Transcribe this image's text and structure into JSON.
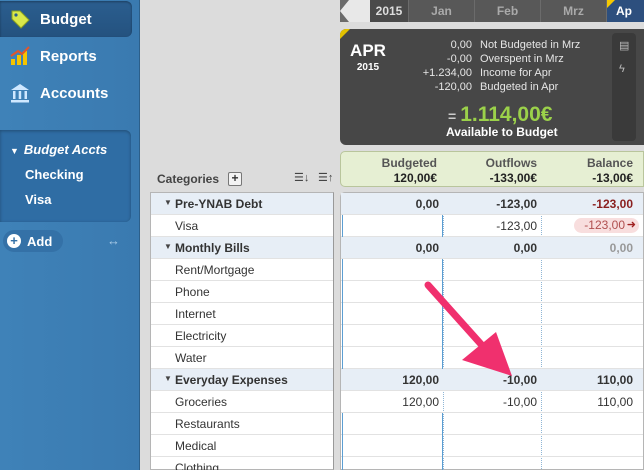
{
  "sidebar": {
    "nav": [
      {
        "label": "Budget",
        "icon": "tag-icon"
      },
      {
        "label": "Reports",
        "icon": "chart-icon"
      },
      {
        "label": "Accounts",
        "icon": "bank-icon"
      }
    ],
    "accounts_header": "Budget Accts",
    "accounts": [
      "Checking",
      "Visa"
    ],
    "add_label": "Add"
  },
  "months": {
    "year": "2015",
    "items": [
      "Jan",
      "Feb",
      "Mrz",
      "Ap"
    ]
  },
  "summary": {
    "month": "APR",
    "year": "2015",
    "rows": [
      {
        "value": "0,00",
        "label": "Not Budgeted in Mrz"
      },
      {
        "value": "-0,00",
        "label": "Overspent in Mrz"
      },
      {
        "value": "+1.234,00",
        "label": "Income for Apr"
      },
      {
        "value": "-120,00",
        "label": "Budgeted in Apr"
      }
    ],
    "equals": "=",
    "available_amount": "1.114,00€",
    "available_label": "Available to Budget"
  },
  "categories_header": {
    "title": "Categories",
    "add": "+"
  },
  "columns": {
    "budgeted": {
      "title": "Budgeted",
      "total": "120,00€"
    },
    "outflows": {
      "title": "Outflows",
      "total": "-133,00€"
    },
    "balance": {
      "title": "Balance",
      "total": "-13,00€"
    }
  },
  "rows": [
    {
      "type": "group",
      "name": "Pre-YNAB Debt",
      "budgeted": "0,00",
      "outflows": "-123,00",
      "balance": "-123,00"
    },
    {
      "type": "item",
      "name": "Visa",
      "budgeted": "",
      "outflows": "-123,00",
      "balance": "-123,00"
    },
    {
      "type": "group",
      "name": "Monthly Bills",
      "budgeted": "0,00",
      "outflows": "0,00",
      "balance": "0,00"
    },
    {
      "type": "item",
      "name": "Rent/Mortgage",
      "budgeted": "",
      "outflows": "",
      "balance": ""
    },
    {
      "type": "item",
      "name": "Phone",
      "budgeted": "",
      "outflows": "",
      "balance": ""
    },
    {
      "type": "item",
      "name": "Internet",
      "budgeted": "",
      "outflows": "",
      "balance": ""
    },
    {
      "type": "item",
      "name": "Electricity",
      "budgeted": "",
      "outflows": "",
      "balance": ""
    },
    {
      "type": "item",
      "name": "Water",
      "budgeted": "",
      "outflows": "",
      "balance": ""
    },
    {
      "type": "group",
      "name": "Everyday Expenses",
      "budgeted": "120,00",
      "outflows": "-10,00",
      "balance": "110,00"
    },
    {
      "type": "item",
      "name": "Groceries",
      "budgeted": "120,00",
      "outflows": "-10,00",
      "balance": "110,00"
    },
    {
      "type": "item",
      "name": "Restaurants",
      "budgeted": "",
      "outflows": "",
      "balance": ""
    },
    {
      "type": "item",
      "name": "Medical",
      "budgeted": "",
      "outflows": "",
      "balance": ""
    },
    {
      "type": "item",
      "name": "Clothing",
      "budgeted": "",
      "outflows": "",
      "balance": ""
    }
  ],
  "colors": {
    "sidebar": "#3a7ab0",
    "available": "#9bd14a",
    "negative": "#8a1f1f",
    "annotation_arrow": "#f0306e"
  }
}
